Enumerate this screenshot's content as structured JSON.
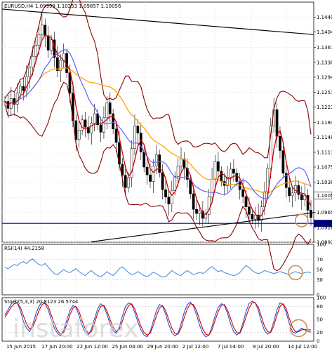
{
  "chart_data": {
    "type": "candlestick",
    "header": {
      "symbol": "EURUSD,H4",
      "ohlc": [
        "1.09999",
        "1.10253",
        "1.09857",
        "1.10056"
      ]
    },
    "price_axis": {
      "ticks": [
        "1.14400",
        "1.14040",
        "1.13670",
        "1.13300",
        "1.12940",
        "1.12570",
        "1.12210",
        "1.11840",
        "1.11480",
        "1.11110",
        "1.10750",
        "1.10380",
        "1.10010",
        "1.09650",
        "1.09280",
        "1.08920"
      ],
      "ylim": [
        1.0892,
        1.1477
      ],
      "current_price": "1.10056",
      "support_level": "1.09379"
    },
    "time_axis": {
      "labels": [
        "15 Jun 2015",
        "17 Jun 20:00",
        "22 Jun 12:00",
        "25 Jun 04:00",
        "29 Jun 20:00",
        "2 Jul 12:00",
        "7 Jul 04:00",
        "9 Jul 20:00",
        "14 Jul 12:00"
      ]
    },
    "series": [
      {
        "name": "price",
        "color": "#d40000",
        "values": [
          1.1235,
          1.1218,
          1.1242,
          1.1228,
          1.1255,
          1.1272,
          1.1261,
          1.1295,
          1.1318,
          1.1345,
          1.1372,
          1.1398,
          1.1421,
          1.1395,
          1.136,
          1.1385,
          1.1342,
          1.131,
          1.1335,
          1.1352,
          1.1305,
          1.1255,
          1.1188,
          1.1142,
          1.1165,
          1.119,
          1.1172,
          1.1158,
          1.1182,
          1.1205,
          1.1178,
          1.116,
          1.1195,
          1.1232,
          1.1205,
          1.1168,
          1.1135,
          1.1082,
          1.1055,
          1.1025,
          1.105,
          1.112,
          1.1175,
          1.1158,
          1.1112,
          1.1075,
          1.1056,
          1.104,
          1.1078,
          1.1105,
          1.1062,
          1.102,
          1.1002,
          1.0985,
          1.1018,
          1.1052,
          1.1078,
          1.1095,
          1.1072,
          1.1045,
          1.101,
          1.0972,
          1.0962,
          1.0968,
          1.095,
          1.096,
          1.1002,
          1.1045,
          1.1088,
          1.1065,
          1.104,
          1.103,
          1.105,
          1.107,
          1.106,
          1.104,
          1.102,
          1.1003,
          1.0978,
          1.096,
          1.0948,
          1.0958,
          1.0945,
          1.0978,
          1.1015,
          1.1072,
          1.1175,
          1.1215,
          1.115,
          1.1115,
          1.106,
          1.1025,
          1.1005,
          1.1012,
          1.103,
          1.1008,
          1.0995,
          1.1006,
          1.097,
          1.0952
        ]
      },
      {
        "name": "ma-fast",
        "color": "#6060ff"
      },
      {
        "name": "ma-slow",
        "color": "#ffa500"
      },
      {
        "name": "bollinger",
        "color": "#8b0000"
      }
    ],
    "trendlines": {
      "resistance": {
        "from": [
          1.146
        ],
        "to": [
          1.1398
        ]
      },
      "support": {
        "from": [
          1.0893
        ],
        "to": [
          1.0964
        ]
      },
      "horizontal_support": 1.09379
    },
    "rsi": {
      "label": "RSI(14) 44.2158",
      "ticks": [
        "100",
        "70",
        "50",
        "30",
        "0"
      ],
      "values": [
        54,
        52,
        56,
        60,
        58,
        63,
        66,
        62,
        68,
        71,
        65,
        60,
        58,
        62,
        55,
        48,
        42,
        40,
        45,
        50,
        46,
        44,
        48,
        52,
        46,
        42,
        38,
        44,
        48,
        42,
        38,
        36,
        40,
        46,
        42,
        38,
        44,
        52,
        55,
        50,
        44,
        40,
        42,
        46,
        42,
        38,
        36,
        40,
        45,
        42,
        38,
        35,
        36,
        42,
        48,
        44,
        40,
        38,
        44,
        48,
        44,
        40,
        42,
        45,
        42,
        46,
        52,
        56,
        50,
        46,
        48,
        44,
        42,
        40,
        38,
        40,
        44,
        52,
        58,
        54,
        48,
        44,
        42,
        44,
        48,
        46,
        44,
        42,
        44,
        46,
        44,
        42,
        40,
        44,
        46,
        44,
        42,
        44,
        45,
        44
      ]
    },
    "stochastic": {
      "label": "Stoch(5,3,3) 20.8123 26.5744",
      "ticks": [
        "100",
        "80",
        "50",
        "20",
        "0"
      ],
      "main": [
        60,
        72,
        85,
        92,
        88,
        70,
        45,
        30,
        22,
        38,
        62,
        80,
        90,
        86,
        72,
        50,
        30,
        18,
        12,
        25,
        48,
        70,
        82,
        78,
        58,
        35,
        20,
        14,
        28,
        52,
        74,
        86,
        80,
        62,
        40,
        24,
        18,
        32,
        58,
        80,
        88,
        84,
        66,
        44,
        26,
        14,
        10,
        22,
        46,
        70,
        84,
        80,
        62,
        38,
        20,
        12,
        18,
        40,
        66,
        84,
        90,
        80,
        60,
        36,
        18,
        10,
        14,
        34,
        58,
        78,
        86,
        82,
        64,
        40,
        22,
        14,
        20,
        42,
        68,
        86,
        92,
        88,
        70,
        44,
        24,
        16,
        22,
        46,
        72,
        88,
        84,
        66,
        40,
        22,
        18,
        24,
        30,
        26,
        22,
        21
      ],
      "signal": [
        55,
        66,
        78,
        86,
        88,
        78,
        58,
        40,
        28,
        32,
        50,
        70,
        84,
        88,
        80,
        60,
        40,
        24,
        16,
        20,
        38,
        60,
        76,
        80,
        68,
        46,
        28,
        18,
        22,
        42,
        64,
        80,
        82,
        70,
        50,
        32,
        22,
        26,
        46,
        68,
        82,
        86,
        74,
        54,
        34,
        20,
        14,
        18,
        36,
        58,
        76,
        82,
        70,
        50,
        30,
        18,
        16,
        30,
        54,
        74,
        86,
        84,
        70,
        48,
        28,
        16,
        14,
        26,
        48,
        68,
        82,
        84,
        72,
        52,
        32,
        20,
        18,
        34,
        56,
        76,
        88,
        88,
        78,
        56,
        34,
        22,
        20,
        36,
        60,
        80,
        86,
        74,
        52,
        32,
        22,
        22,
        26,
        27,
        26,
        26
      ]
    },
    "watermark": "instaforex"
  }
}
